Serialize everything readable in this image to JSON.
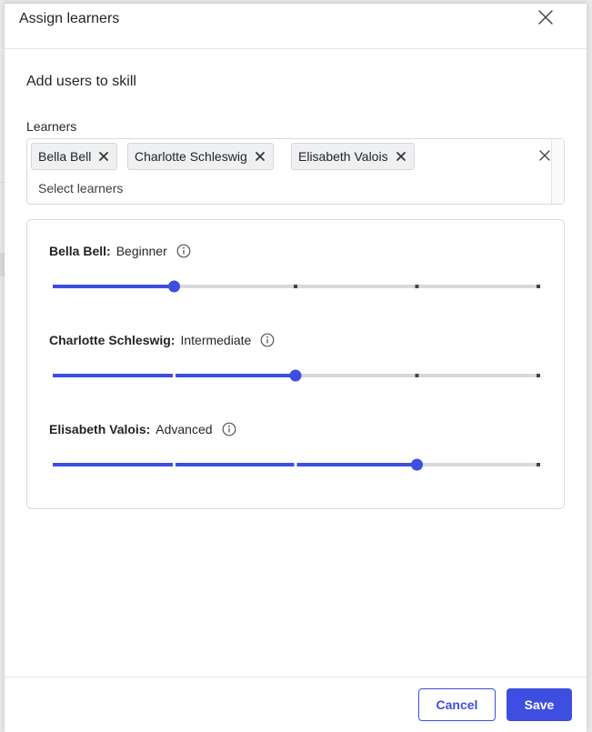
{
  "modal": {
    "title": "Assign learners",
    "close_icon": "close-icon"
  },
  "section": {
    "heading": "Add users to skill"
  },
  "learners_field": {
    "label": "Learners",
    "placeholder": "Select learners",
    "chips": [
      {
        "label": "Bella Bell",
        "remove_icon": "x-icon"
      },
      {
        "label": "Charlotte Schleswig",
        "remove_icon": "x-icon"
      },
      {
        "label": "Elisabeth Valois",
        "remove_icon": "x-icon"
      }
    ],
    "clear_icon": "close-icon"
  },
  "proficiency": {
    "levels_count": 5,
    "accent": "#3d4ee0",
    "track_color": "#d6d9dd",
    "rows": [
      {
        "name": "Bella Bell:",
        "level": "Beginner",
        "value": 1,
        "info_icon": "info-icon"
      },
      {
        "name": "Charlotte Schleswig:",
        "level": "Intermediate",
        "value": 2,
        "info_icon": "info-icon"
      },
      {
        "name": "Elisabeth Valois:",
        "level": "Advanced",
        "value": 3,
        "info_icon": "info-icon"
      }
    ]
  },
  "footer": {
    "cancel_label": "Cancel",
    "save_label": "Save"
  },
  "colors": {
    "primary": "#3d4ee0",
    "border": "#d9dadf"
  }
}
